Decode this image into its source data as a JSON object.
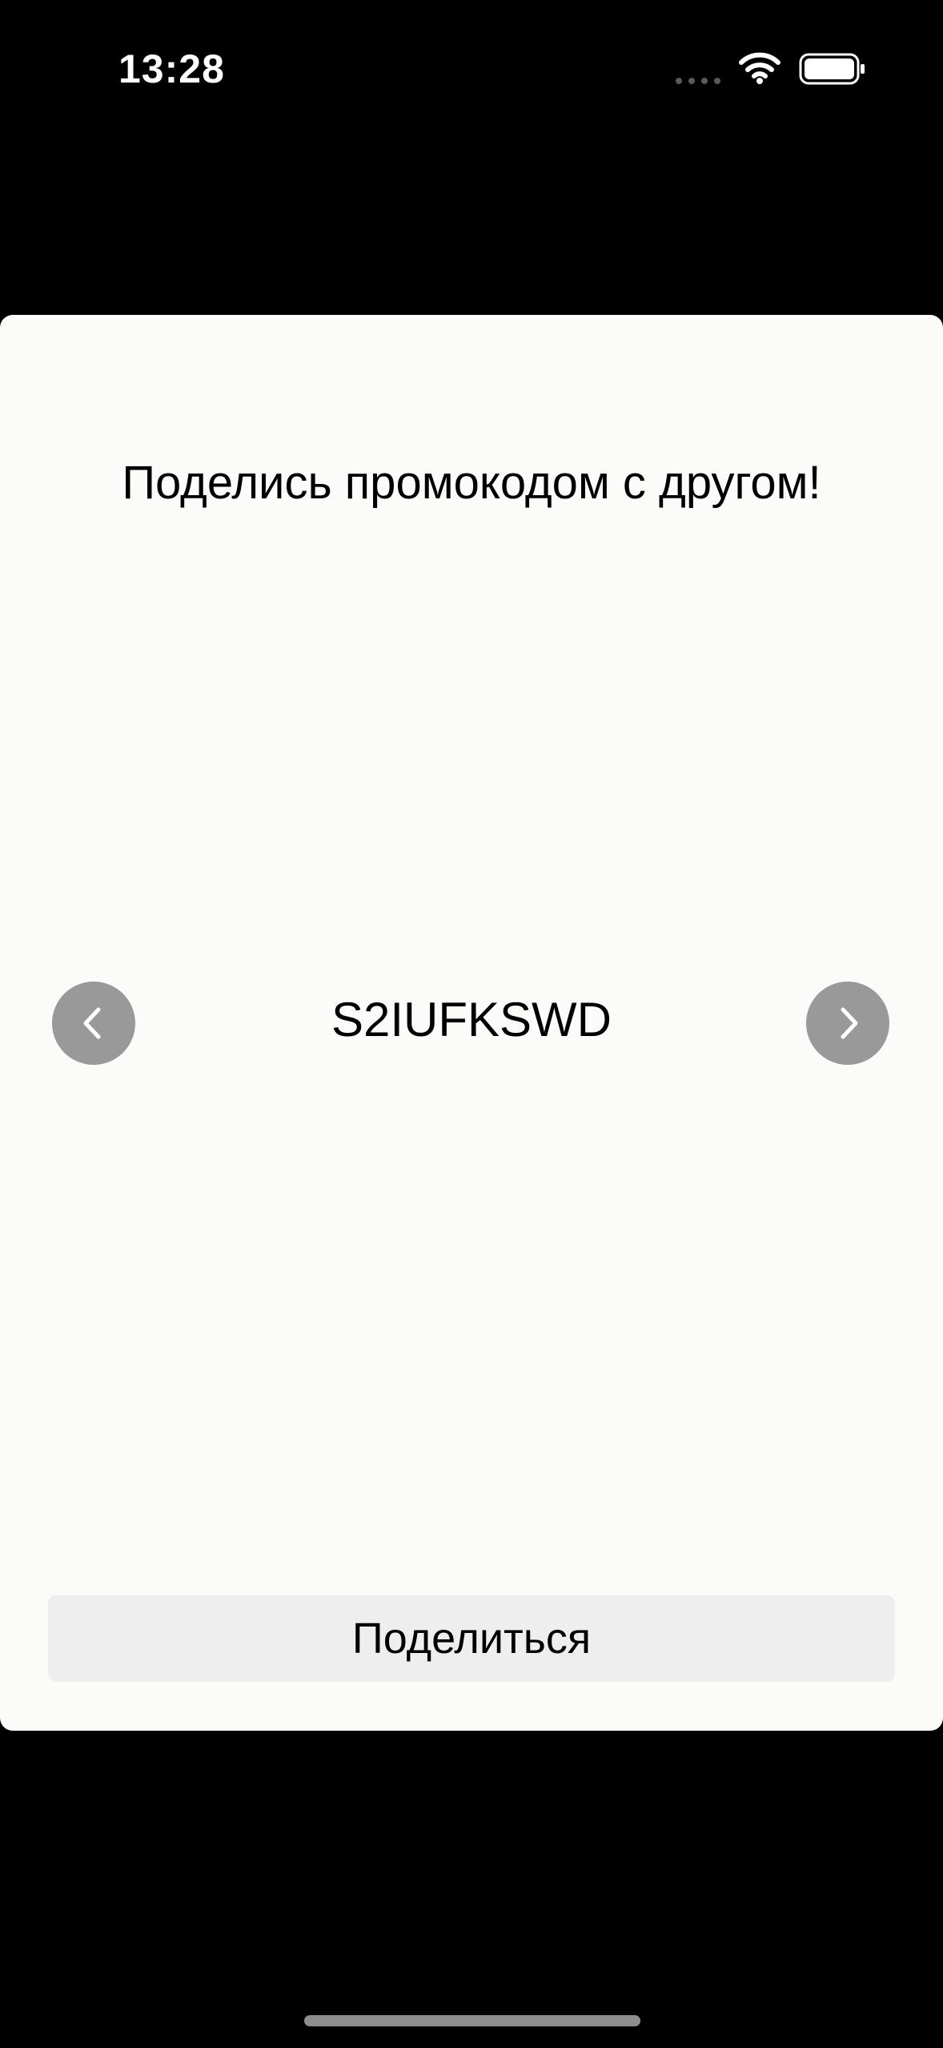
{
  "status_bar": {
    "time": "13:28",
    "icons": [
      "signal-dots-icon",
      "wifi-icon",
      "battery-icon"
    ]
  },
  "sheet": {
    "title": "Поделись промокодом с другом!",
    "promo_code": "S2IUFKSWD",
    "prev_icon": "chevron-left-icon",
    "next_icon": "chevron-right-icon",
    "share_label": "Поделиться"
  },
  "colors": {
    "background": "#000000",
    "sheet": "#fbfbf9",
    "nav_button": "#999999",
    "share_button": "#eeeeee",
    "text": "#000000"
  }
}
